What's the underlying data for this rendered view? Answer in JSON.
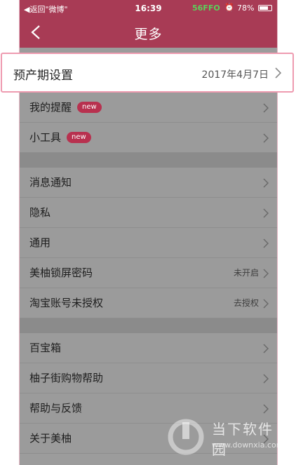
{
  "status_bar": {
    "back_app": "◀返回\"微博\"",
    "time": "16:39",
    "network": "56FFO",
    "battery_pct": "78%",
    "battery_level": 0.78
  },
  "nav": {
    "title": "更多"
  },
  "highlight": {
    "label": "预产期设置",
    "value": "2017年4月7日"
  },
  "section1": [
    {
      "label": "我的提醒",
      "badge": "new"
    },
    {
      "label": "小工具",
      "badge": "new"
    }
  ],
  "section2": [
    {
      "label": "消息通知"
    },
    {
      "label": "隐私"
    },
    {
      "label": "通用"
    },
    {
      "label": "美柚锁屏密码",
      "value": "未开启"
    },
    {
      "label": "淘宝账号未授权",
      "value": "去授权"
    }
  ],
  "section3": [
    {
      "label": "百宝箱"
    },
    {
      "label": "柚子街购物帮助"
    },
    {
      "label": "帮助与反馈"
    },
    {
      "label": "关于美柚"
    }
  ],
  "watermark": {
    "text": "当下软件园",
    "url": "www.downxia.com"
  },
  "colors": {
    "brand": "#a83b55",
    "badge": "#b8314f",
    "highlight_border": "#ee9bb0"
  }
}
